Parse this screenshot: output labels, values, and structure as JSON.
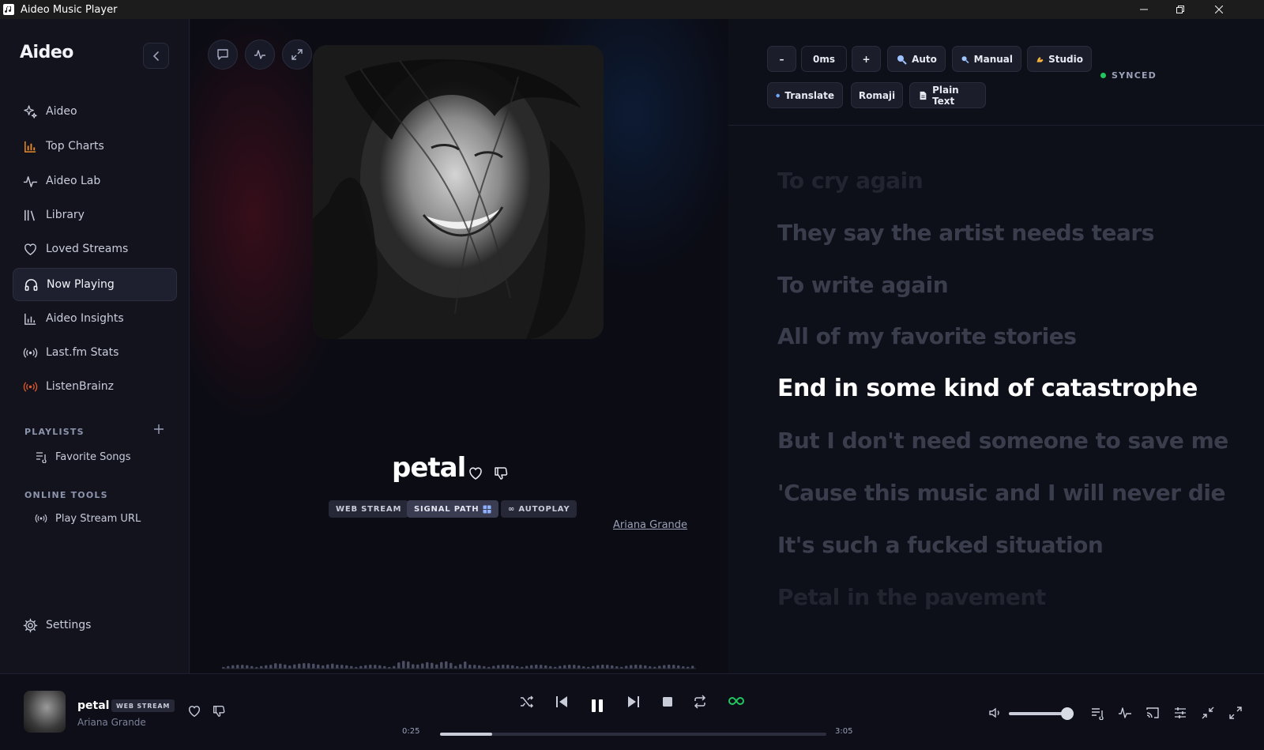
{
  "window": {
    "title": "Aideo Music Player"
  },
  "sidebar": {
    "brand": "Aideo",
    "nav": [
      {
        "label": "Aideo",
        "icon": "sparkle-icon"
      },
      {
        "label": "Top Charts",
        "icon": "bar-chart-icon"
      },
      {
        "label": "Aideo Lab",
        "icon": "pulse-icon"
      },
      {
        "label": "Library",
        "icon": "library-icon"
      },
      {
        "label": "Loved Streams",
        "icon": "heart-icon"
      },
      {
        "label": "Now Playing",
        "icon": "headphones-icon"
      },
      {
        "label": "Aideo Insights",
        "icon": "insights-icon"
      },
      {
        "label": "Last.fm Stats",
        "icon": "broadcast-icon"
      },
      {
        "label": "ListenBrainz",
        "icon": "broadcast-icon"
      }
    ],
    "playlists_label": "PLAYLISTS",
    "playlists": [
      {
        "label": "Favorite Songs"
      }
    ],
    "online_tools_label": "ONLINE TOOLS",
    "online_tools": [
      {
        "label": "Play Stream URL"
      }
    ],
    "settings_label": "Settings"
  },
  "now_playing": {
    "title": "petal",
    "artist": "Ariana Grande",
    "tags": [
      "WEB STREAM",
      "SIGNAL PATH",
      "∞ AUTOPLAY"
    ]
  },
  "lyrics_toolbar": {
    "minus": "–",
    "offset": "0ms",
    "plus": "+",
    "auto": "Auto",
    "manual": "Manual",
    "studio": "Studio",
    "synced": "SYNCED",
    "translate": "Translate",
    "romaji": "Romaji",
    "plain_text": "Plain Text"
  },
  "lyrics": {
    "lines": [
      "To cry again",
      "They say the artist needs tears",
      "To write again",
      "All of my favorite stories",
      "End in some kind of catastrophe",
      "But I don't need someone to save me",
      "'Cause this music and I will never die",
      "It's such a fucked situation",
      "Petal in the pavement"
    ],
    "current_index": 4
  },
  "player": {
    "title": "petal",
    "tag": "WEB STREAM",
    "artist": "Ariana Grande",
    "elapsed": "0:25",
    "duration": "3:05",
    "progress": 0.135,
    "volume": 0.8
  },
  "colors": {
    "accent_green": "#22c55e",
    "listenbrainz_orange": "#e0592a",
    "charts_orange": "#e8892b"
  }
}
